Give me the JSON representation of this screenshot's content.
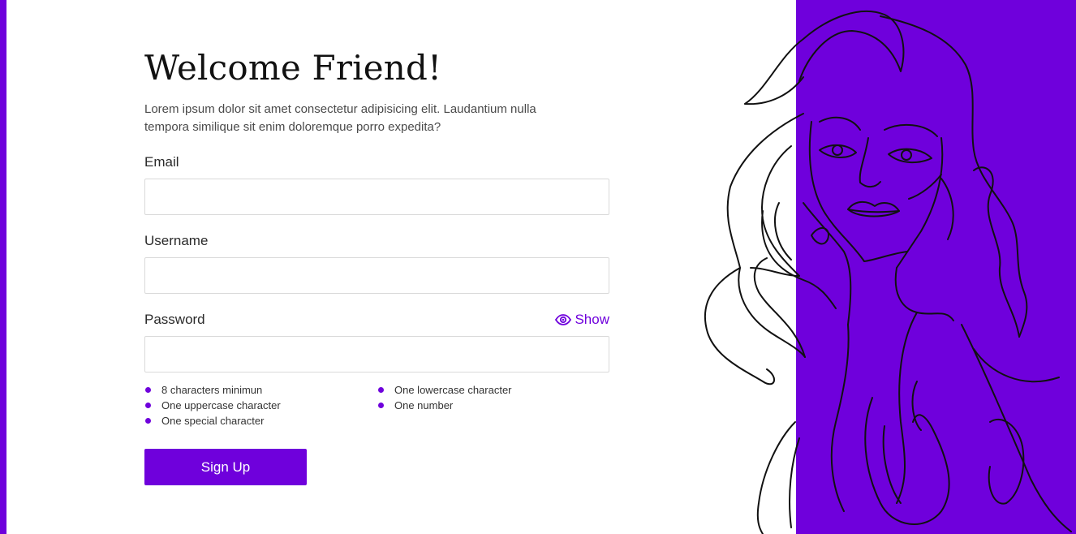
{
  "form": {
    "title": "Welcome Friend!",
    "subtitle": "Lorem ipsum dolor sit amet consectetur adipisicing elit. Laudantium nulla tempora similique sit enim doloremque porro expedita?",
    "email": {
      "label": "Email",
      "value": "",
      "placeholder": ""
    },
    "username": {
      "label": "Username",
      "value": "",
      "placeholder": ""
    },
    "password": {
      "label": "Password",
      "value": "",
      "placeholder": "",
      "show_label": "Show",
      "show_icon": "eye-icon"
    },
    "requirements": [
      "8 characters minimun",
      "One lowercase character",
      "One uppercase character",
      "One number",
      "One special character"
    ],
    "submit_label": "Sign Up"
  },
  "colors": {
    "accent": "#6f00dc",
    "line_art": "#111111"
  },
  "decoration": {
    "illustration": "woman-line-art"
  }
}
